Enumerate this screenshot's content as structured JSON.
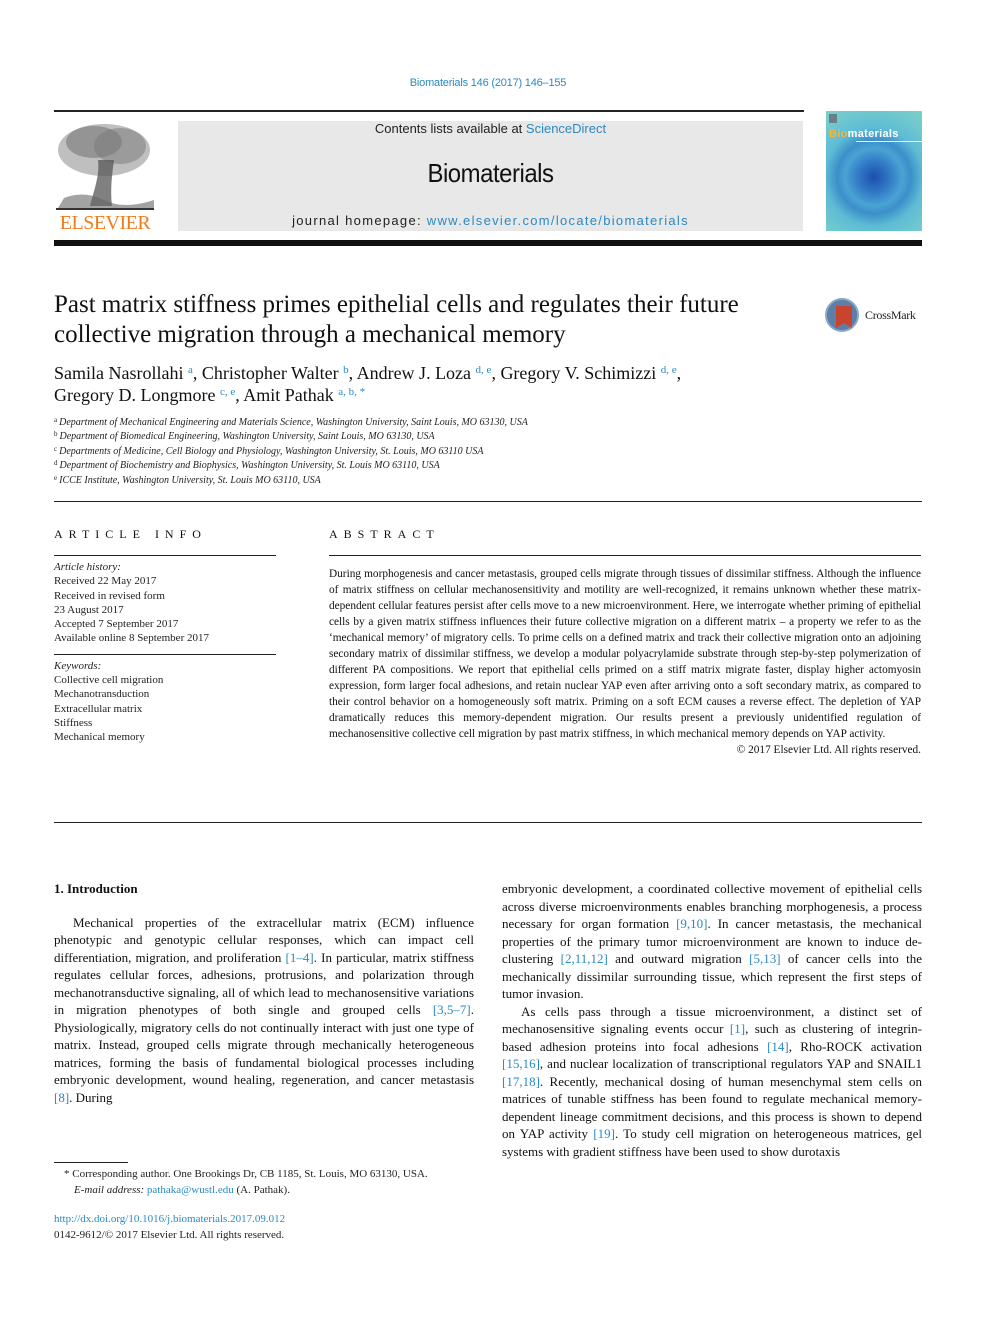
{
  "header": {
    "journal_citation": "Biomaterials 146 (2017) 146–155",
    "publisher_logo_text": "ELSEVIER",
    "contents_prefix": "Contents lists available at ",
    "contents_link": "ScienceDirect",
    "journal_name": "Biomaterials",
    "homepage_prefix": "journal homepage: ",
    "homepage_link": "www.elsevier.com/locate/biomaterials",
    "cover_title_accent": "Bio",
    "cover_title_rest": "materials",
    "crossmark_label": "CrossMark"
  },
  "article": {
    "title": "Past matrix stiffness primes epithelial cells and regulates their future collective migration through a mechanical memory",
    "authors": [
      {
        "name": "Samila Nasrollahi",
        "sup": "a",
        "sep": ", "
      },
      {
        "name": "Christopher Walter",
        "sup": "b",
        "sep": ", "
      },
      {
        "name": "Andrew J. Loza",
        "sup": "d, e",
        "sep": ", "
      },
      {
        "name": "Gregory V. Schimizzi",
        "sup": "d, e",
        "sep": ","
      },
      {
        "name": "Gregory D. Longmore",
        "sup": "c, e",
        "sep": ", "
      },
      {
        "name": "Amit Pathak",
        "sup": "a, b, *",
        "sep": ""
      }
    ],
    "affiliations": [
      {
        "key": "a",
        "text": "Department of Mechanical Engineering and Materials Science, Washington University, Saint Louis, MO 63130, USA"
      },
      {
        "key": "b",
        "text": "Department of Biomedical Engineering, Washington University, Saint Louis, MO 63130, USA"
      },
      {
        "key": "c",
        "text": "Departments of Medicine, Cell Biology and Physiology, Washington University, St. Louis, MO 63110 USA"
      },
      {
        "key": "d",
        "text": "Department of Biochemistry and Biophysics, Washington University, St. Louis MO 63110, USA"
      },
      {
        "key": "e",
        "text": "ICCE Institute, Washington University, St. Louis MO 63110, USA"
      }
    ]
  },
  "article_info": {
    "heading": "ARTICLE INFO",
    "history_label": "Article history:",
    "history": [
      "Received 22 May 2017",
      "Received in revised form",
      "23 August 2017",
      "Accepted 7 September 2017",
      "Available online 8 September 2017"
    ],
    "keywords_label": "Keywords:",
    "keywords": [
      "Collective cell migration",
      "Mechanotransduction",
      "Extracellular matrix",
      "Stiffness",
      "Mechanical memory"
    ]
  },
  "abstract": {
    "heading": "ABSTRACT",
    "text": "During morphogenesis and cancer metastasis, grouped cells migrate through tissues of dissimilar stiffness. Although the influence of matrix stiffness on cellular mechanosensitivity and motility are well-recognized, it remains unknown whether these matrix-dependent cellular features persist after cells move to a new microenvironment. Here, we interrogate whether priming of epithelial cells by a given matrix stiffness influences their future collective migration on a different matrix – a property we refer to as the ‘mechanical memory’ of migratory cells. To prime cells on a defined matrix and track their collective migration onto an adjoining secondary matrix of dissimilar stiffness, we develop a modular polyacrylamide substrate through step-by-step polymerization of different PA compositions. We report that epithelial cells primed on a stiff matrix migrate faster, display higher actomyosin expression, form larger focal adhesions, and retain nuclear YAP even after arriving onto a soft secondary matrix, as compared to their control behavior on a homogeneously soft matrix. Priming on a soft ECM causes a reverse effect. The depletion of YAP dramatically reduces this memory-dependent migration. Our results present a previously unidentified regulation of mechanosensitive collective cell migration by past matrix stiffness, in which mechanical memory depends on YAP activity.",
    "copyright": "© 2017 Elsevier Ltd. All rights reserved."
  },
  "introduction": {
    "heading": "1.  Introduction",
    "left_paragraph": [
      {
        "t": "Mechanical properties of the extracellular matrix (ECM) influence phenotypic and genotypic cellular responses, which can impact cell differentiation, migration, and proliferation "
      },
      {
        "ref": "[1–4]"
      },
      {
        "t": ". In particular, matrix stiffness regulates cellular forces, adhesions, protrusions, and polarization through mechanotransductive signaling, all of which lead to mechanosensitive variations in migration phenotypes of both single and grouped cells "
      },
      {
        "ref": "[3,5–7]"
      },
      {
        "t": ". Physiologically, migratory cells do not continually interact with just one type of matrix. Instead, grouped cells migrate through mechanically heterogeneous matrices, forming the basis of fundamental biological processes including embryonic development, wound healing, regeneration, and cancer metastasis "
      },
      {
        "ref": "[8]"
      },
      {
        "t": ". During"
      }
    ],
    "right_paragraph_1": [
      {
        "t": "embryonic development, a coordinated collective movement of epithelial cells across diverse microenvironments enables branching morphogenesis, a process necessary for organ formation "
      },
      {
        "ref": "[9,10]"
      },
      {
        "t": ". In cancer metastasis, the mechanical properties of the primary tumor microenvironment are known to induce de-clustering "
      },
      {
        "ref": "[2,11,12]"
      },
      {
        "t": " and outward migration "
      },
      {
        "ref": "[5,13]"
      },
      {
        "t": " of cancer cells into the mechanically dissimilar surrounding tissue, which represent the first steps of tumor invasion."
      }
    ],
    "right_paragraph_2": [
      {
        "t": "As cells pass through a tissue microenvironment, a distinct set of mechanosensitive signaling events occur "
      },
      {
        "ref": "[1]"
      },
      {
        "t": ", such as clustering of integrin-based adhesion proteins into focal adhesions "
      },
      {
        "ref": "[14]"
      },
      {
        "t": ", Rho-ROCK activation "
      },
      {
        "ref": "[15,16]"
      },
      {
        "t": ", and nuclear localization of transcriptional regulators YAP and SNAIL1 "
      },
      {
        "ref": "[17,18]"
      },
      {
        "t": ". Recently, mechanical dosing of human mesenchymal stem cells on matrices of tunable stiffness has been found to regulate mechanical memory-dependent lineage commitment decisions, and this process is shown to depend on YAP activity "
      },
      {
        "ref": "[19]"
      },
      {
        "t": ". To study cell migration on heterogeneous matrices, gel systems with gradient stiffness have been used to show durotaxis"
      }
    ]
  },
  "footnote": {
    "star": "*",
    "corresponding": " Corresponding author. One Brookings Dr, CB 1185, St. Louis, MO 63130, USA.",
    "email_label": "E-mail address:",
    "email": "pathaka@wustl.edu",
    "email_suffix": " (A. Pathak)."
  },
  "doi": {
    "link": "http://dx.doi.org/10.1016/j.biomaterials.2017.09.012",
    "issn_line": "0142-9612/© 2017 Elsevier Ltd. All rights reserved."
  },
  "colors": {
    "link": "#2a8ac2",
    "elsevier_orange": "#f07b1a",
    "banner_gray": "#e8e8e8"
  }
}
